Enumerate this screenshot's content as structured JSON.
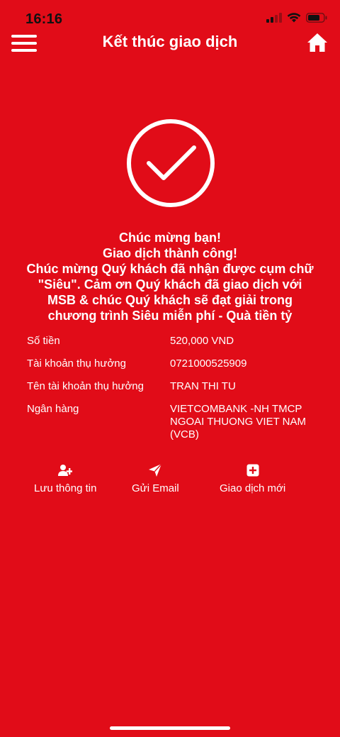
{
  "status": {
    "time": "16:16"
  },
  "header": {
    "title": "Kết thúc giao dịch"
  },
  "message": {
    "lines": [
      "Chúc mừng bạn!",
      "Giao dịch thành công!",
      "Chúc mừng Quý khách đã nhận được cụm chữ",
      "\"Siêu\". Cảm ơn Quý khách đã giao dịch với",
      "MSB & chúc Quý khách sẽ đạt giải trong",
      "chương trình Siêu miễn phí - Quà tiền tỷ"
    ]
  },
  "details": [
    {
      "label": "Số tiền",
      "value": "520,000 VND"
    },
    {
      "label": "Tài khoản thụ hưởng",
      "value": "0721000525909"
    },
    {
      "label": "Tên tài khoản thụ hưởng",
      "value": "TRAN THI TU"
    },
    {
      "label": "Ngân hàng",
      "value": "VIETCOMBANK -NH TMCP\nNGOAI THUONG VIET NAM\n(VCB)"
    }
  ],
  "actions": [
    {
      "label": "Lưu thông tin",
      "icon": "add-user-icon"
    },
    {
      "label": "Gửi Email",
      "icon": "send-icon"
    },
    {
      "label": "Giao dịch mới",
      "icon": "plus-square-icon"
    }
  ],
  "colors": {
    "background": "#e10c18",
    "foreground": "#ffffff"
  }
}
